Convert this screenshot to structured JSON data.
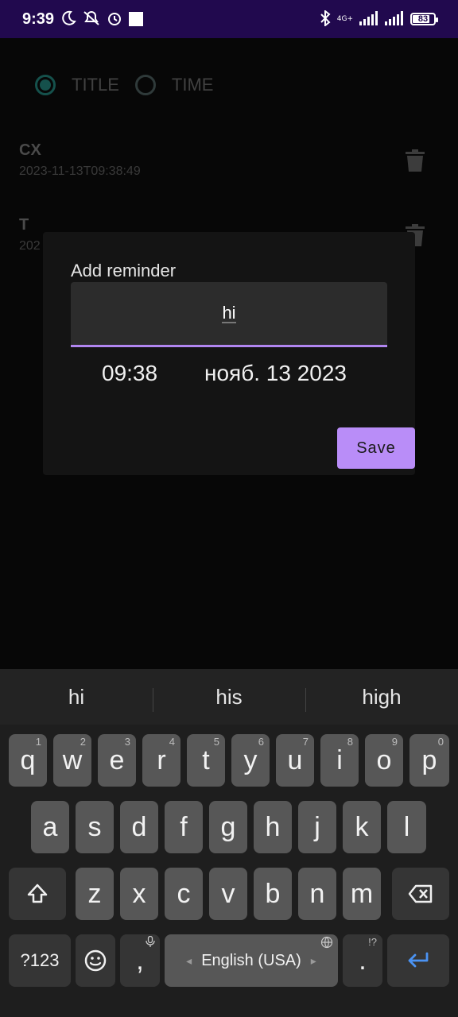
{
  "status_bar": {
    "time": "9:39",
    "network_label_top": "4G+",
    "network_label_bottom": "",
    "battery": "83"
  },
  "sort": {
    "options": [
      {
        "label": "TITLE",
        "checked": true
      },
      {
        "label": "TIME",
        "checked": false
      }
    ]
  },
  "reminders": [
    {
      "title": "CX",
      "date": "2023-11-13T09:38:49"
    },
    {
      "title": "T",
      "date": "202"
    }
  ],
  "dialog": {
    "title": "Add reminder",
    "input_value": "hi",
    "time": "09:38",
    "date": "нояб. 13 2023",
    "save_label": "Save",
    "accent_color": "#b98df8"
  },
  "keyboard": {
    "suggestions": [
      "hi",
      "his",
      "high"
    ],
    "row1": [
      {
        "key": "q",
        "hint": "1"
      },
      {
        "key": "w",
        "hint": "2"
      },
      {
        "key": "e",
        "hint": "3"
      },
      {
        "key": "r",
        "hint": "4"
      },
      {
        "key": "t",
        "hint": "5"
      },
      {
        "key": "y",
        "hint": "6"
      },
      {
        "key": "u",
        "hint": "7"
      },
      {
        "key": "i",
        "hint": "8"
      },
      {
        "key": "o",
        "hint": "9"
      },
      {
        "key": "p",
        "hint": "0"
      }
    ],
    "row2": [
      "a",
      "s",
      "d",
      "f",
      "g",
      "h",
      "j",
      "k",
      "l"
    ],
    "row3": [
      "z",
      "x",
      "c",
      "v",
      "b",
      "n",
      "m"
    ],
    "symbols_label": "?123",
    "comma": ",",
    "space_label": "English (USA)",
    "period": ".",
    "period_hint": "!?"
  }
}
